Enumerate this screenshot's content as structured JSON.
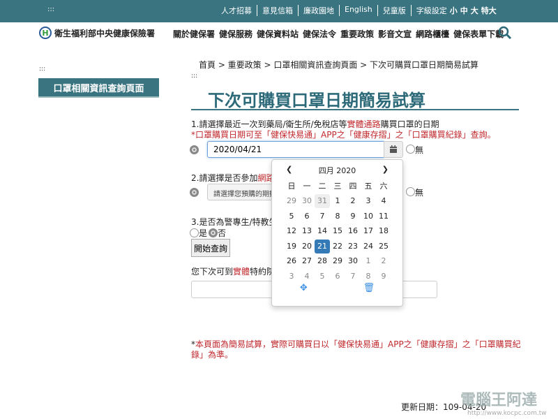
{
  "topbar": {
    "links": [
      "人才招募",
      "意見信箱",
      "廉政園地",
      "English",
      "兒童版"
    ],
    "font_size_label": "字級設定",
    "font_sizes": [
      "小",
      "中",
      "大",
      "特大"
    ],
    "accesskey": ":::"
  },
  "header": {
    "logo_text": "衛生福利部中央健康保險署",
    "logo_mark": "H",
    "nav": [
      "關於健保署",
      "健保服務",
      "健保資料站",
      "健保法令",
      "重要政策",
      "影音文宣",
      "網路櫃檯",
      "健保表單下載"
    ]
  },
  "sidebar": {
    "accesskey": ":::",
    "button": "口罩相關資訊查詢頁面"
  },
  "breadcrumb": "首頁 > 重要政策 > 口罩相關資訊查詢頁面 > 下次可購買口罩日期簡易試算",
  "main": {
    "accesskey": ":::",
    "title": "下次可購買口罩日期簡易試算",
    "q1": {
      "a": "1.請選擇最近一次到藥局/衛生所/免稅店等",
      "b": "實體通路",
      "c": "購買口罩的日期",
      "note": "*口罩購買日期可至「健保快易通」APP之「健康存摺」之「口罩購買紀錄」查詢。",
      "date_value": "2020/04/21",
      "none_label": "無"
    },
    "q2": {
      "a": "2.請選擇是否參加",
      "b": "網路預",
      "select_placeholder": "請選擇您預購的期數",
      "none_label": "無"
    },
    "q3": {
      "label": "3.是否為警專生/特教生",
      "yes": "是",
      "no": "否"
    },
    "start_button": "開始查詢",
    "result": {
      "a": "您下次可到",
      "b": "實體",
      "c": "特約院"
    },
    "footnote": {
      "star": "*",
      "text": "本頁面為簡易試算，實際可購買日以「健保快易通」APP之「健康存摺」之「口罩購買紀錄」為準。"
    },
    "update": "更新日期：109-04-20"
  },
  "calendar": {
    "title": "四月 2020",
    "weekdays": [
      "日",
      "一",
      "二",
      "三",
      "四",
      "五",
      "六"
    ],
    "days": [
      "29",
      "30",
      "31",
      "1",
      "2",
      "3",
      "4",
      "5",
      "6",
      "7",
      "8",
      "9",
      "10",
      "11",
      "12",
      "13",
      "14",
      "15",
      "16",
      "17",
      "18",
      "19",
      "20",
      "21",
      "22",
      "23",
      "24",
      "25",
      "26",
      "27",
      "28",
      "29",
      "30",
      "1",
      "2",
      "3",
      "4",
      "5",
      "6",
      "7",
      "8",
      "9"
    ],
    "selected": "21",
    "accent": "#337ab7"
  },
  "watermark": {
    "text": "電腦王阿達",
    "url": "http://www.kocpc.com.tw"
  },
  "colors": {
    "brand": "#3a7481",
    "red": "#c0282d"
  }
}
